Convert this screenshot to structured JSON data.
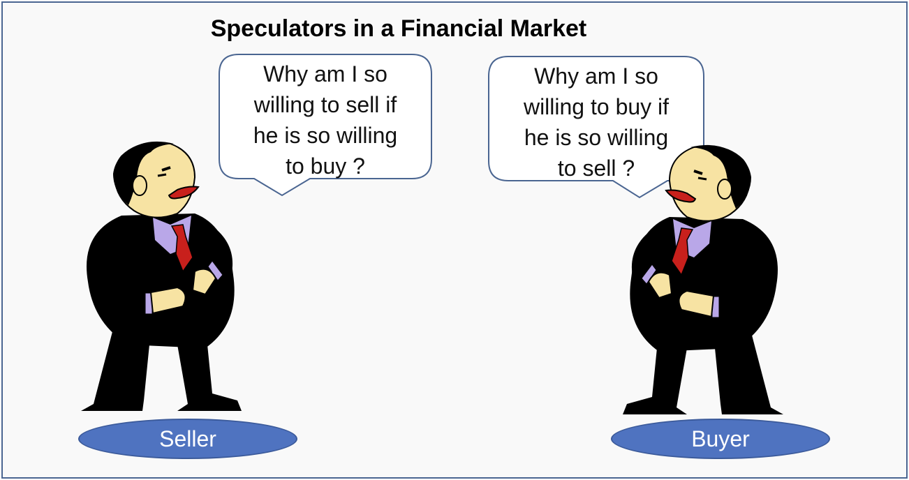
{
  "title": "Speculators in a Financial Market",
  "seller_bubble": {
    "lines": [
      "Why am I so",
      "willing to sell if",
      "he is so willing",
      "to buy ?"
    ]
  },
  "buyer_bubble": {
    "lines": [
      "Why am I so",
      "willing to buy if",
      "he is so willing",
      "to sell ?"
    ]
  },
  "labels": {
    "seller": "Seller",
    "buyer": "Buyer"
  },
  "colors": {
    "frame_border": "#4a6591",
    "label_fill": "#4f73c0",
    "bubble_border": "#4a6591",
    "suit": "#000000",
    "skin": "#f7e3a3",
    "shirt": "#b9a7e8",
    "tie": "#c8201c"
  },
  "icons": [
    "businessman-seller-icon",
    "businessman-buyer-icon"
  ]
}
